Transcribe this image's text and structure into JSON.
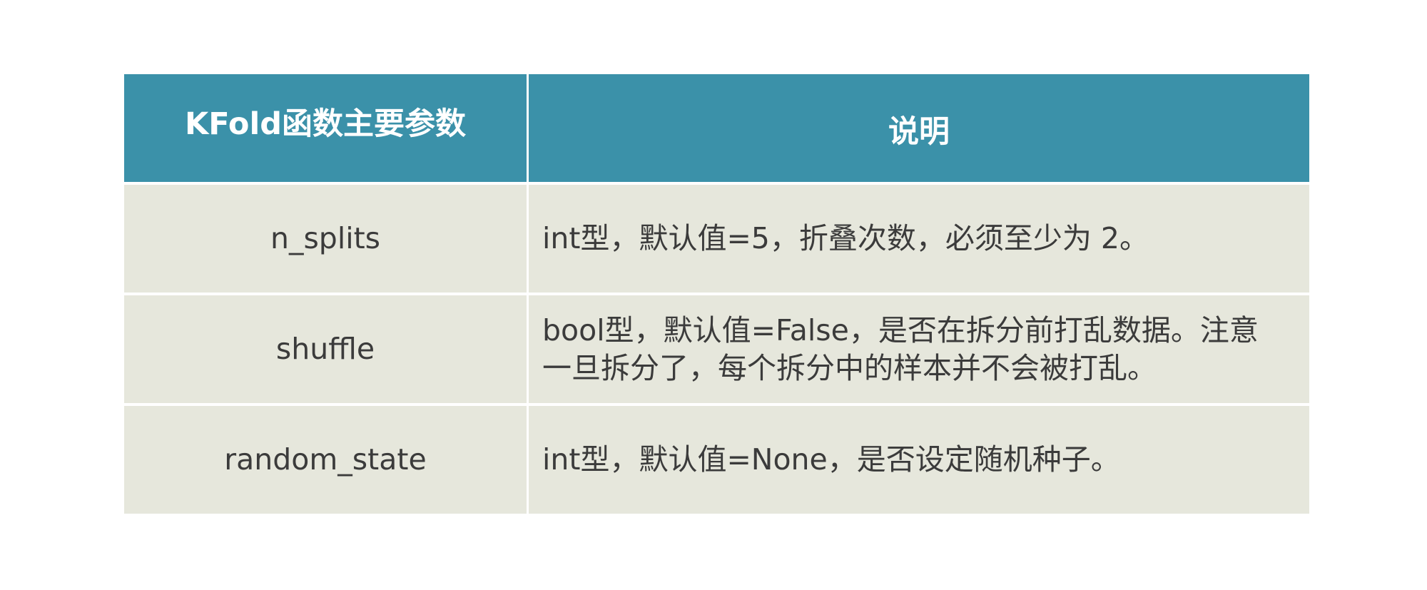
{
  "table": {
    "headers": {
      "param": "KFold函数主要参数",
      "desc": "说明"
    },
    "rows": [
      {
        "param": "n_splits",
        "desc": "int型，默认值=5，折叠次数，必须至少为 2。"
      },
      {
        "param": "shuffle",
        "desc": "bool型，默认值=False，是否在拆分前打乱数据。注意一旦拆分了，每个拆分中的样本并不会被打乱。"
      },
      {
        "param": "random_state",
        "desc": "int型，默认值=None，是否设定随机种子。"
      }
    ],
    "colors": {
      "header_bg": "#3b91a9",
      "row_bg": "#e6e7dc",
      "text": "#3b3b3b",
      "header_text": "#ffffff"
    }
  }
}
